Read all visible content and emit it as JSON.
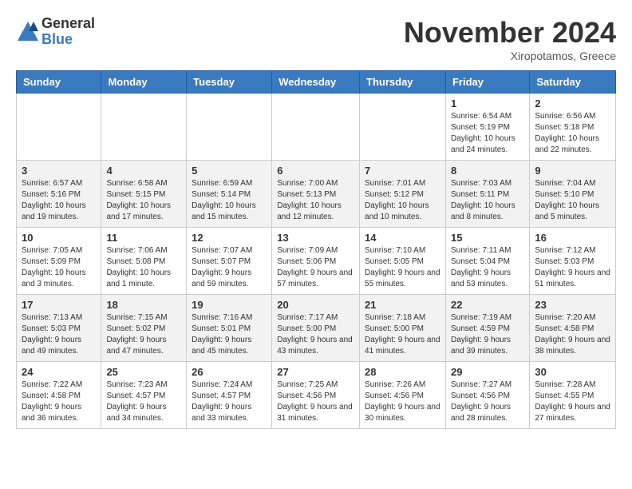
{
  "header": {
    "logo": {
      "general": "General",
      "blue": "Blue"
    },
    "title": "November 2024",
    "location": "Xiropotamos, Greece"
  },
  "calendar": {
    "weekdays": [
      "Sunday",
      "Monday",
      "Tuesday",
      "Wednesday",
      "Thursday",
      "Friday",
      "Saturday"
    ],
    "weeks": [
      [
        {
          "day": "",
          "info": ""
        },
        {
          "day": "",
          "info": ""
        },
        {
          "day": "",
          "info": ""
        },
        {
          "day": "",
          "info": ""
        },
        {
          "day": "",
          "info": ""
        },
        {
          "day": "1",
          "info": "Sunrise: 6:54 AM\nSunset: 5:19 PM\nDaylight: 10 hours and 24 minutes."
        },
        {
          "day": "2",
          "info": "Sunrise: 6:56 AM\nSunset: 5:18 PM\nDaylight: 10 hours and 22 minutes."
        }
      ],
      [
        {
          "day": "3",
          "info": "Sunrise: 6:57 AM\nSunset: 5:16 PM\nDaylight: 10 hours and 19 minutes."
        },
        {
          "day": "4",
          "info": "Sunrise: 6:58 AM\nSunset: 5:15 PM\nDaylight: 10 hours and 17 minutes."
        },
        {
          "day": "5",
          "info": "Sunrise: 6:59 AM\nSunset: 5:14 PM\nDaylight: 10 hours and 15 minutes."
        },
        {
          "day": "6",
          "info": "Sunrise: 7:00 AM\nSunset: 5:13 PM\nDaylight: 10 hours and 12 minutes."
        },
        {
          "day": "7",
          "info": "Sunrise: 7:01 AM\nSunset: 5:12 PM\nDaylight: 10 hours and 10 minutes."
        },
        {
          "day": "8",
          "info": "Sunrise: 7:03 AM\nSunset: 5:11 PM\nDaylight: 10 hours and 8 minutes."
        },
        {
          "day": "9",
          "info": "Sunrise: 7:04 AM\nSunset: 5:10 PM\nDaylight: 10 hours and 5 minutes."
        }
      ],
      [
        {
          "day": "10",
          "info": "Sunrise: 7:05 AM\nSunset: 5:09 PM\nDaylight: 10 hours and 3 minutes."
        },
        {
          "day": "11",
          "info": "Sunrise: 7:06 AM\nSunset: 5:08 PM\nDaylight: 10 hours and 1 minute."
        },
        {
          "day": "12",
          "info": "Sunrise: 7:07 AM\nSunset: 5:07 PM\nDaylight: 9 hours and 59 minutes."
        },
        {
          "day": "13",
          "info": "Sunrise: 7:09 AM\nSunset: 5:06 PM\nDaylight: 9 hours and 57 minutes."
        },
        {
          "day": "14",
          "info": "Sunrise: 7:10 AM\nSunset: 5:05 PM\nDaylight: 9 hours and 55 minutes."
        },
        {
          "day": "15",
          "info": "Sunrise: 7:11 AM\nSunset: 5:04 PM\nDaylight: 9 hours and 53 minutes."
        },
        {
          "day": "16",
          "info": "Sunrise: 7:12 AM\nSunset: 5:03 PM\nDaylight: 9 hours and 51 minutes."
        }
      ],
      [
        {
          "day": "17",
          "info": "Sunrise: 7:13 AM\nSunset: 5:03 PM\nDaylight: 9 hours and 49 minutes."
        },
        {
          "day": "18",
          "info": "Sunrise: 7:15 AM\nSunset: 5:02 PM\nDaylight: 9 hours and 47 minutes."
        },
        {
          "day": "19",
          "info": "Sunrise: 7:16 AM\nSunset: 5:01 PM\nDaylight: 9 hours and 45 minutes."
        },
        {
          "day": "20",
          "info": "Sunrise: 7:17 AM\nSunset: 5:00 PM\nDaylight: 9 hours and 43 minutes."
        },
        {
          "day": "21",
          "info": "Sunrise: 7:18 AM\nSunset: 5:00 PM\nDaylight: 9 hours and 41 minutes."
        },
        {
          "day": "22",
          "info": "Sunrise: 7:19 AM\nSunset: 4:59 PM\nDaylight: 9 hours and 39 minutes."
        },
        {
          "day": "23",
          "info": "Sunrise: 7:20 AM\nSunset: 4:58 PM\nDaylight: 9 hours and 38 minutes."
        }
      ],
      [
        {
          "day": "24",
          "info": "Sunrise: 7:22 AM\nSunset: 4:58 PM\nDaylight: 9 hours and 36 minutes."
        },
        {
          "day": "25",
          "info": "Sunrise: 7:23 AM\nSunset: 4:57 PM\nDaylight: 9 hours and 34 minutes."
        },
        {
          "day": "26",
          "info": "Sunrise: 7:24 AM\nSunset: 4:57 PM\nDaylight: 9 hours and 33 minutes."
        },
        {
          "day": "27",
          "info": "Sunrise: 7:25 AM\nSunset: 4:56 PM\nDaylight: 9 hours and 31 minutes."
        },
        {
          "day": "28",
          "info": "Sunrise: 7:26 AM\nSunset: 4:56 PM\nDaylight: 9 hours and 30 minutes."
        },
        {
          "day": "29",
          "info": "Sunrise: 7:27 AM\nSunset: 4:56 PM\nDaylight: 9 hours and 28 minutes."
        },
        {
          "day": "30",
          "info": "Sunrise: 7:28 AM\nSunset: 4:55 PM\nDaylight: 9 hours and 27 minutes."
        }
      ]
    ]
  }
}
